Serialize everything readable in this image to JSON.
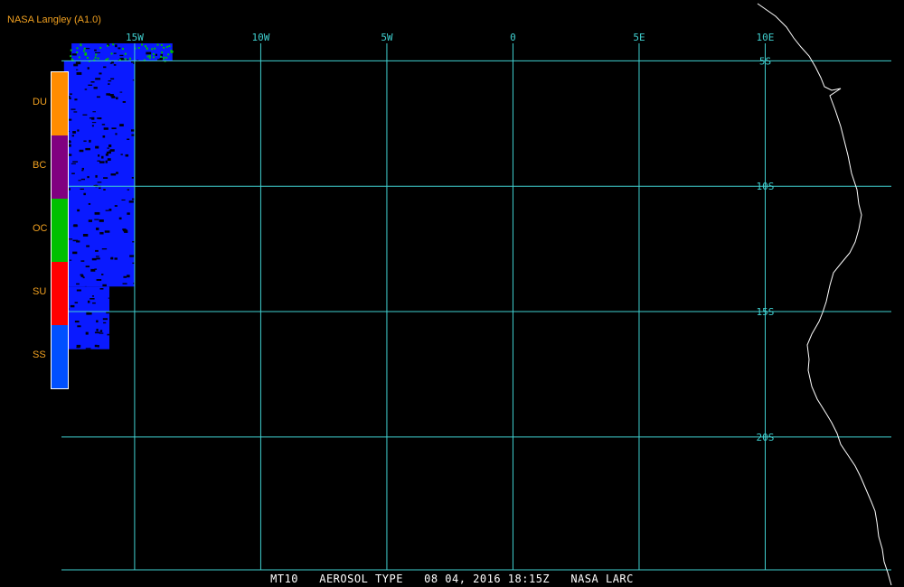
{
  "header": {
    "title": "NASA Langley (A1.0)"
  },
  "legend": {
    "items": [
      {
        "code": "DU",
        "color": "#ff8c00"
      },
      {
        "code": "BC",
        "color": "#800080"
      },
      {
        "code": "OC",
        "color": "#00c000"
      },
      {
        "code": "SU",
        "color": "#ff0000"
      },
      {
        "code": "SS",
        "color": "#0050ff"
      }
    ]
  },
  "map": {
    "grid_color": "#40d0d0",
    "coast_color": "#ffffff",
    "longitude_labels": [
      "15W",
      "10W",
      "5W",
      "0",
      "5E",
      "10E"
    ],
    "latitude_labels": [
      "5S",
      "10S",
      "15S",
      "20S"
    ],
    "extent": {
      "lon_min": -17.9,
      "lon_max": 15.0,
      "lat_min": -25.3,
      "lat_max": -4.3
    },
    "aerosol_coverage": [
      {
        "type": "SS",
        "lon_range": [
          -17.8,
          -15.0
        ],
        "lat_range": [
          -5.0,
          -14.0
        ]
      },
      {
        "type": "SS",
        "lon_range": [
          -17.8,
          -16.0
        ],
        "lat_range": [
          -14.0,
          -16.5
        ]
      },
      {
        "type": "SS",
        "lon_range": [
          -17.5,
          -13.5
        ],
        "lat_range": [
          -4.3,
          -5.0
        ]
      },
      {
        "type": "OC",
        "lon_range": [
          -17.6,
          -13.5
        ],
        "lat_range": [
          -4.3,
          -5.0
        ]
      }
    ]
  },
  "caption": {
    "product": "MT10",
    "title": "AEROSOL TYPE",
    "date": "08 04, 2016 18:15Z",
    "source": "NASA LARC"
  }
}
